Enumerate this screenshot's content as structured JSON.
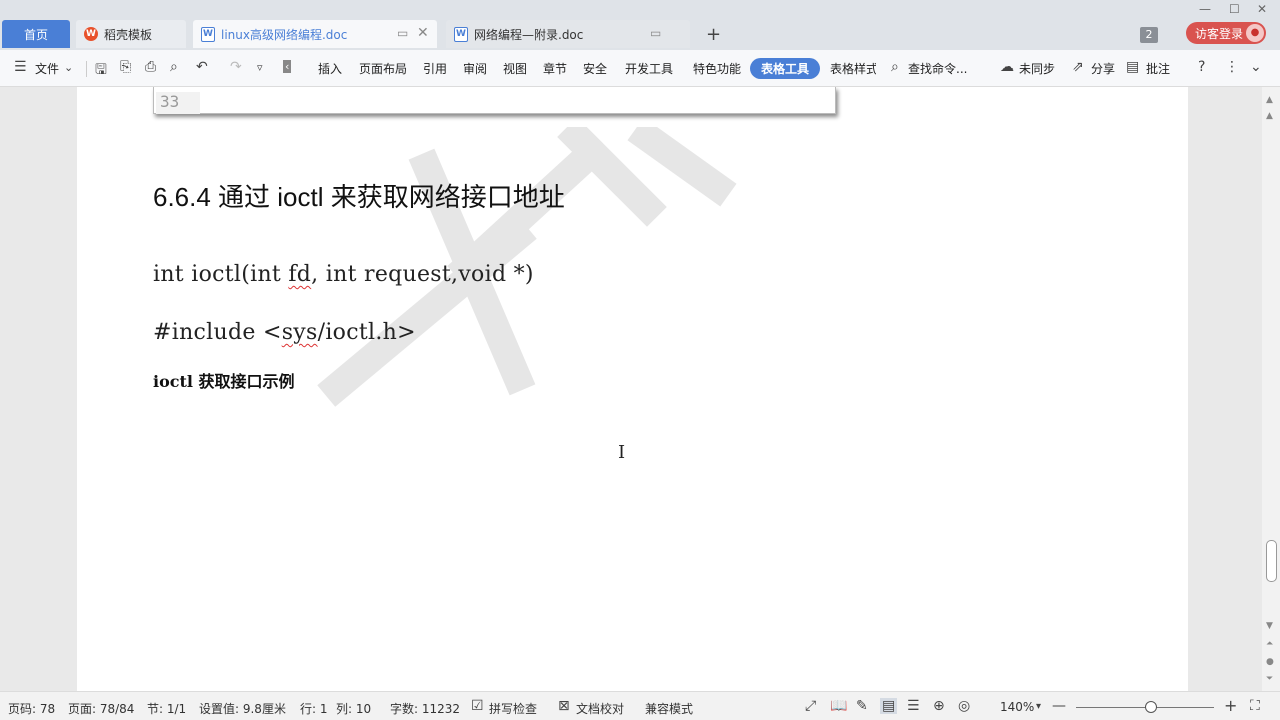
{
  "tabs": {
    "home": "首页",
    "template": "稻壳模板",
    "doc1": "linux高级网络编程.doc",
    "doc2": "网络编程—附录.doc",
    "new_tab": "+",
    "badge_count": "2",
    "login": "访客登录"
  },
  "ribbon": {
    "file": "文件",
    "insert": "插入",
    "layout": "页面布局",
    "reference": "引用",
    "review": "审阅",
    "view": "视图",
    "chapter": "章节",
    "security": "安全",
    "dev_tools": "开发工具",
    "special": "特色功能",
    "table_tools": "表格工具",
    "table_style": "表格样式",
    "search": "查找命令...",
    "sync": "未同步",
    "share": "分享",
    "annotate": "批注"
  },
  "document": {
    "line_number": "33",
    "heading": "6.6.4 通过 ioctl 来获取网络接口地址",
    "code1_a": "int ioctl(int ",
    "code1_fd": "fd",
    "code1_b": ", int request,void *)",
    "code2_a": "#include <",
    "code2_sys": "sys",
    "code2_b": "/ioctl.h>",
    "caption": "ioctl 获取接口示例",
    "watermark_text": "千锋"
  },
  "status": {
    "page_code": "页码: 78",
    "page": "页面: 78/84",
    "section": "节: 1/1",
    "setting": "设置值: 9.8厘米",
    "row": "行: 1",
    "col": "列: 10",
    "word_count": "字数: 11232",
    "spell_check": "拼写检查",
    "doc_proof": "文档校对",
    "compat": "兼容模式",
    "zoom": "140%"
  },
  "colors": {
    "accent": "#4a7fd6",
    "login": "#d9534f",
    "wps_logo": "#e8512b"
  }
}
